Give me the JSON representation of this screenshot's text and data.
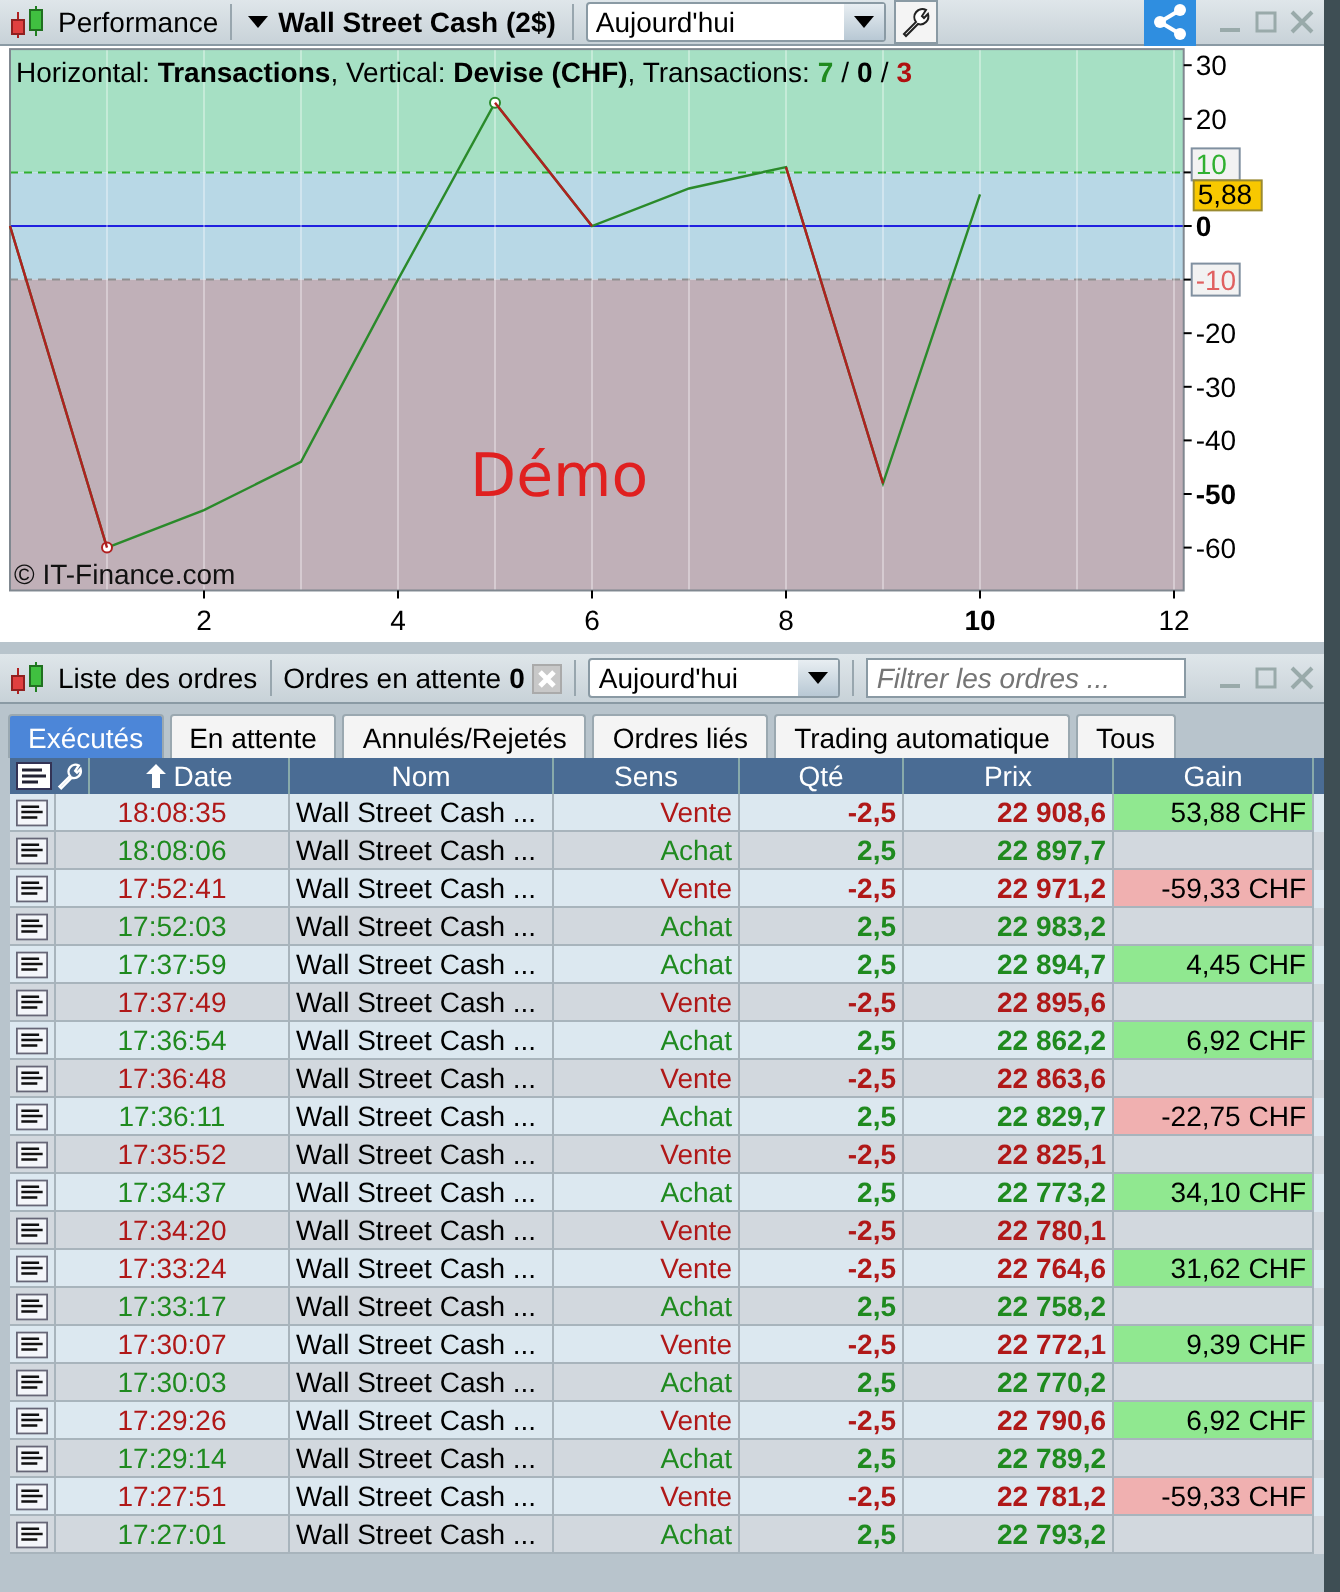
{
  "performance_panel": {
    "title": "Performance",
    "instrument": "Wall Street Cash (2$)",
    "period": "Aujourd'hui",
    "legend": "Horizontal: **Transactions**, Vertical: **Devise (CHF)**, Transactions: ",
    "counts": [
      {
        "value": "7",
        "kind": "win"
      },
      {
        "value": "0",
        "kind": "neutral"
      },
      {
        "value": "3",
        "kind": "loss"
      }
    ],
    "count_separator": "/",
    "chart_data": {
      "type": "line",
      "x": [
        0,
        1,
        2,
        3,
        4,
        5,
        6,
        7,
        8,
        9,
        10
      ],
      "series": [
        {
          "color": "#2a8a2a",
          "values": [
            0,
            -60,
            -53,
            -44,
            -10,
            23,
            0,
            7,
            11,
            -48,
            5.9
          ]
        }
      ],
      "xlim": [
        0,
        12.1
      ],
      "ylim": [
        -68,
        33
      ],
      "grid": true,
      "xticks": [
        2,
        4,
        6,
        8,
        {
          "value": 10,
          "label": "10"
        },
        12
      ],
      "yticks": [
        30,
        20,
        10,
        {
          "value": 0,
          "label": "0"
        },
        -10,
        -20,
        -30,
        -40,
        {
          "value": -50,
          "label": "-50"
        },
        -60
      ],
      "annotations": [
        "5,88"
      ]
    },
    "watermark": "Démo",
    "copyright": "© IT-Finance.com"
  },
  "orders_panel": {
    "title": "Liste des ordres",
    "pending_label": "Ordres en attente",
    "pending_count": "0",
    "period": "Aujourd'hui",
    "filter_placeholder": "Filtrer les ordres ...",
    "tabs": [
      {
        "label": "Exécutés",
        "selected": true
      },
      {
        "label": "En attente",
        "selected": false
      },
      {
        "label": "Annulés/Rejetés",
        "selected": false
      },
      {
        "label": "Ordres liés",
        "selected": false
      },
      {
        "label": "Trading automatique",
        "selected": false
      },
      {
        "label": "Tous",
        "selected": false
      }
    ],
    "columns": [
      "Date",
      "Nom",
      "Sens",
      "Qté",
      "Prix",
      "Gain"
    ],
    "rows": [
      {
        "date": "18:08:35",
        "name": "Wall Street Cash ...",
        "side": "Vente",
        "kind": "sell",
        "qty": "-2,5",
        "price": "22 908,6",
        "gain": "53,88 CHF",
        "color": "#90e890"
      },
      {
        "date": "18:08:06",
        "name": "Wall Street Cash ...",
        "side": "Achat",
        "kind": "buy",
        "qty": "2,5",
        "price": "22 897,7"
      },
      {
        "date": "17:52:41",
        "name": "Wall Street Cash ...",
        "side": "Vente",
        "kind": "sell",
        "qty": "-2,5",
        "price": "22 971,2",
        "gain": "-59,33 CHF",
        "color": "#f0b0b0"
      },
      {
        "date": "17:52:03",
        "name": "Wall Street Cash ...",
        "side": "Achat",
        "kind": "buy",
        "qty": "2,5",
        "price": "22 983,2"
      },
      {
        "date": "17:37:59",
        "name": "Wall Street Cash ...",
        "side": "Achat",
        "kind": "buy",
        "qty": "2,5",
        "price": "22 894,7",
        "gain": "4,45 CHF",
        "color": "#90e890"
      },
      {
        "date": "17:37:49",
        "name": "Wall Street Cash ...",
        "side": "Vente",
        "kind": "sell",
        "qty": "-2,5",
        "price": "22 895,6"
      },
      {
        "date": "17:36:54",
        "name": "Wall Street Cash ...",
        "side": "Achat",
        "kind": "buy",
        "qty": "2,5",
        "price": "22 862,2",
        "gain": "6,92 CHF",
        "color": "#90e890"
      },
      {
        "date": "17:36:48",
        "name": "Wall Street Cash ...",
        "side": "Vente",
        "kind": "sell",
        "qty": "-2,5",
        "price": "22 863,6"
      },
      {
        "date": "17:36:11",
        "name": "Wall Street Cash ...",
        "side": "Achat",
        "kind": "buy",
        "qty": "2,5",
        "price": "22 829,7",
        "gain": "-22,75 CHF",
        "color": "#f0b0b0"
      },
      {
        "date": "17:35:52",
        "name": "Wall Street Cash ...",
        "side": "Vente",
        "kind": "sell",
        "qty": "-2,5",
        "price": "22 825,1"
      },
      {
        "date": "17:34:37",
        "name": "Wall Street Cash ...",
        "side": "Achat",
        "kind": "buy",
        "qty": "2,5",
        "price": "22 773,2",
        "gain": "34,10 CHF",
        "color": "#90e890"
      },
      {
        "date": "17:34:20",
        "name": "Wall Street Cash ...",
        "side": "Vente",
        "kind": "sell",
        "qty": "-2,5",
        "price": "22 780,1"
      },
      {
        "date": "17:33:24",
        "name": "Wall Street Cash ...",
        "side": "Vente",
        "kind": "sell",
        "qty": "-2,5",
        "price": "22 764,6",
        "gain": "31,62 CHF",
        "color": "#90e890"
      },
      {
        "date": "17:33:17",
        "name": "Wall Street Cash ...",
        "side": "Achat",
        "kind": "buy",
        "qty": "2,5",
        "price": "22 758,2"
      },
      {
        "date": "17:30:07",
        "name": "Wall Street Cash ...",
        "side": "Vente",
        "kind": "sell",
        "qty": "-2,5",
        "price": "22 772,1",
        "gain": "9,39 CHF",
        "color": "#90e890"
      },
      {
        "date": "17:30:03",
        "name": "Wall Street Cash ...",
        "side": "Achat",
        "kind": "buy",
        "qty": "2,5",
        "price": "22 770,2"
      },
      {
        "date": "17:29:26",
        "name": "Wall Street Cash ...",
        "side": "Vente",
        "kind": "sell",
        "qty": "-2,5",
        "price": "22 790,6",
        "gain": "6,92 CHF",
        "color": "#90e890"
      },
      {
        "date": "17:29:14",
        "name": "Wall Street Cash ...",
        "side": "Achat",
        "kind": "buy",
        "qty": "2,5",
        "price": "22 789,2"
      },
      {
        "date": "17:27:51",
        "name": "Wall Street Cash ...",
        "side": "Vente",
        "kind": "sell",
        "qty": "-2,5",
        "price": "22 781,2",
        "gain": "-59,33 CHF",
        "color": "#f0b0b0"
      },
      {
        "date": "17:27:01",
        "name": "Wall Street Cash ...",
        "side": "Achat",
        "kind": "buy",
        "qty": "2,5",
        "price": "22 793,2"
      }
    ]
  }
}
